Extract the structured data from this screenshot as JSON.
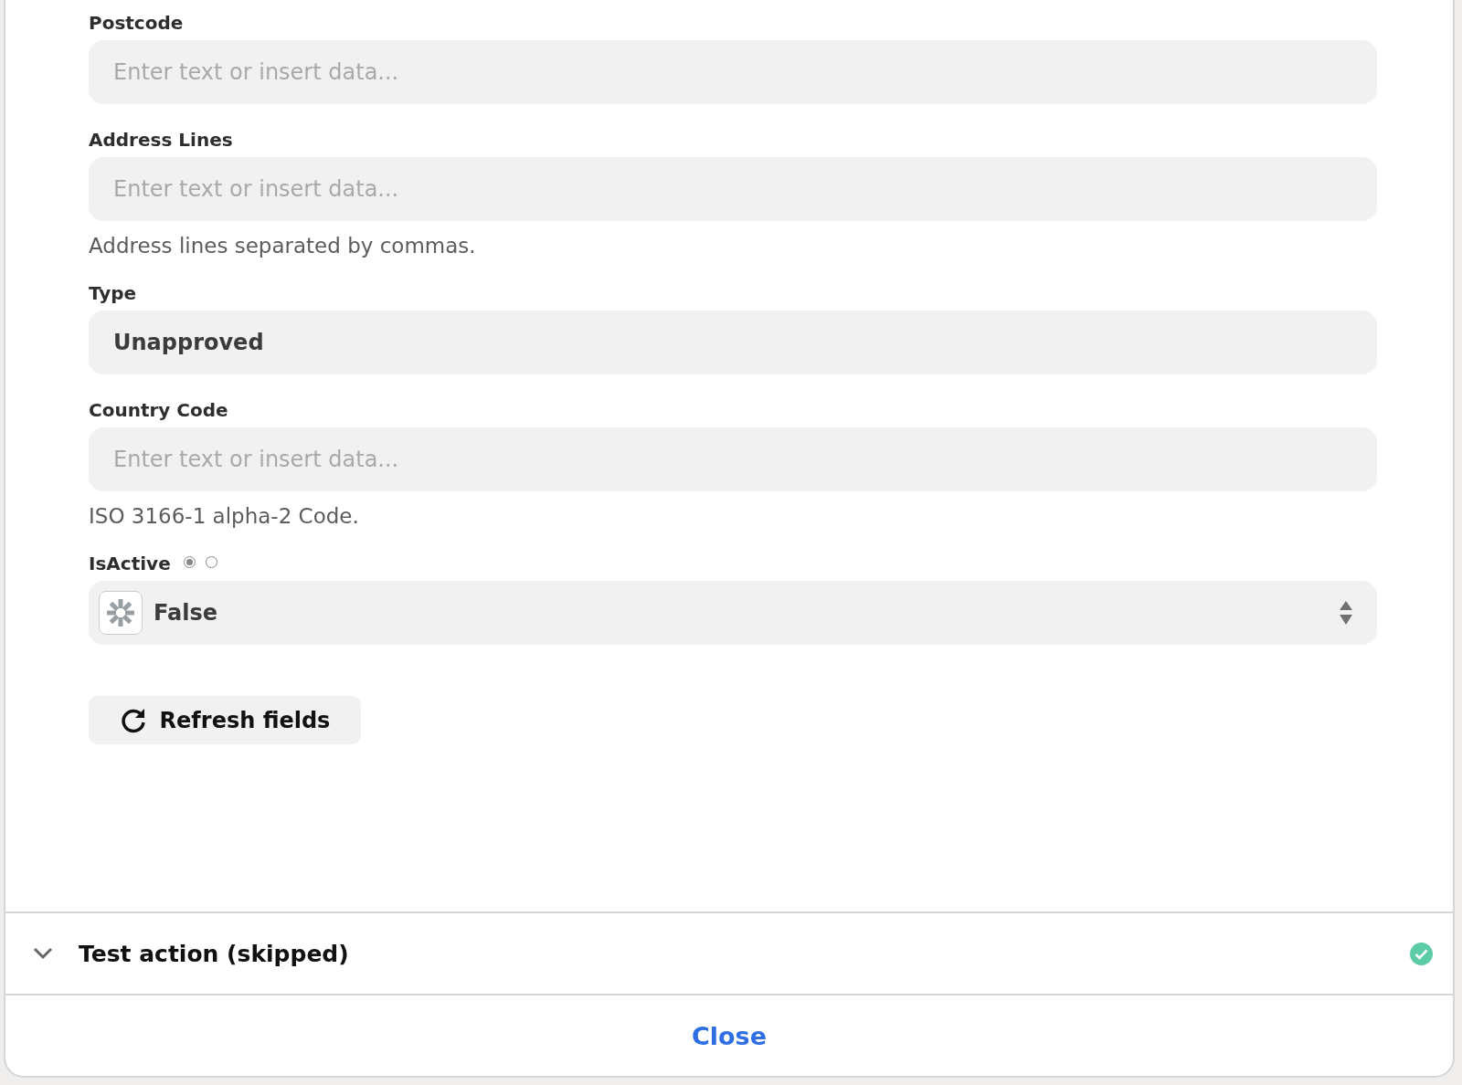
{
  "fields": [
    {
      "kind": "text",
      "label": "Postcode",
      "placeholder": "Enter text or insert data..."
    },
    {
      "kind": "text",
      "label": "Address Lines",
      "placeholder": "Enter text or insert data...",
      "help": "Address lines separated by commas."
    },
    {
      "kind": "text",
      "label": "Type",
      "value": "Unapproved"
    },
    {
      "kind": "text",
      "label": "Country Code",
      "placeholder": "Enter text or insert data...",
      "help": "ISO 3166-1 alpha-2 Code."
    },
    {
      "kind": "dropdown",
      "label": "IsActive",
      "value": "False",
      "modes": [
        {
          "selected": true
        },
        {
          "selected": false
        }
      ]
    }
  ],
  "refresh_button": "Refresh fields",
  "test_section": {
    "title": "Test action (skipped)",
    "expanded": false,
    "complete": true
  },
  "close_button": "Close"
}
